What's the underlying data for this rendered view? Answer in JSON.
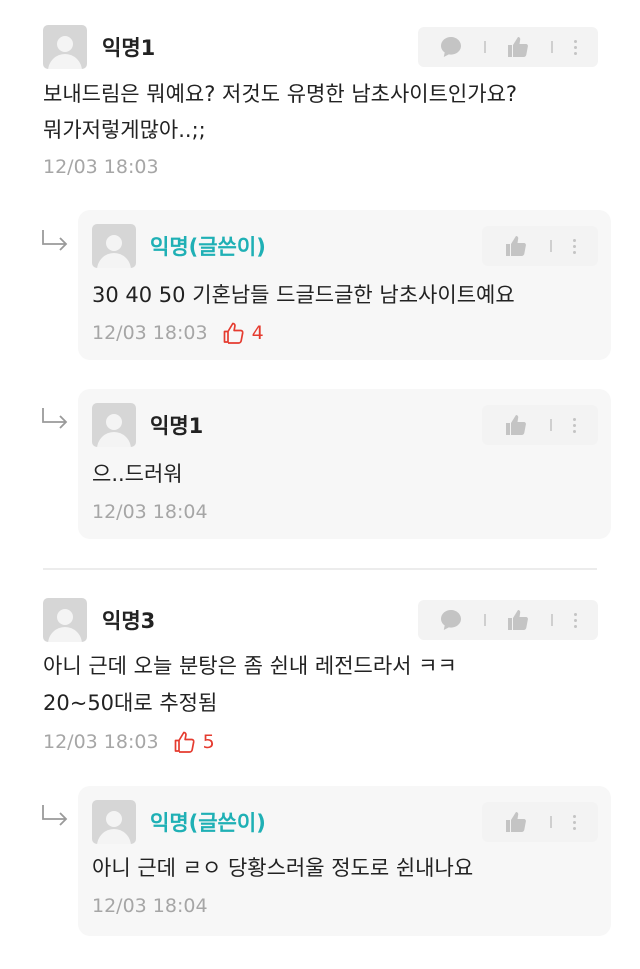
{
  "comments": [
    {
      "author": "익명1",
      "lines": [
        "보내드림은 뭐예요? 저것도 유명한 남초사이트인가요?",
        "뭐가저렇게많아..;;"
      ],
      "time": "12/03 18:03",
      "replies": [
        {
          "author": "익명(글쓴이)",
          "text": "30 40 50 기혼남들 드글드글한 남초사이트예요",
          "time": "12/03 18:03",
          "likes": "4"
        },
        {
          "author": "익명1",
          "text": "으..드러워",
          "time": "12/03 18:04"
        }
      ]
    },
    {
      "author": "익명3",
      "lines": [
        "아니 근데 오늘 분탕은 좀 쉰내 레전드라서 ㅋㅋ",
        "20~50대로 추정됨"
      ],
      "time": "12/03 18:03",
      "likes": "5",
      "replies": [
        {
          "author": "익명(글쓴이)",
          "text": "아니 근데 ㄹㅇ 당황스러울 정도로 쉰내나요",
          "time": "12/03 18:04"
        }
      ]
    }
  ],
  "icons": {
    "chat": "chat-bubble-icon",
    "thumb": "thumbs-up-icon",
    "more": "more-vertical-icon",
    "like_outline": "thumbs-up-outline-icon",
    "reply_arrow": "reply-arrow-icon"
  },
  "colors": {
    "writer": "#1fb0b5",
    "likes": "#e53b2f"
  }
}
